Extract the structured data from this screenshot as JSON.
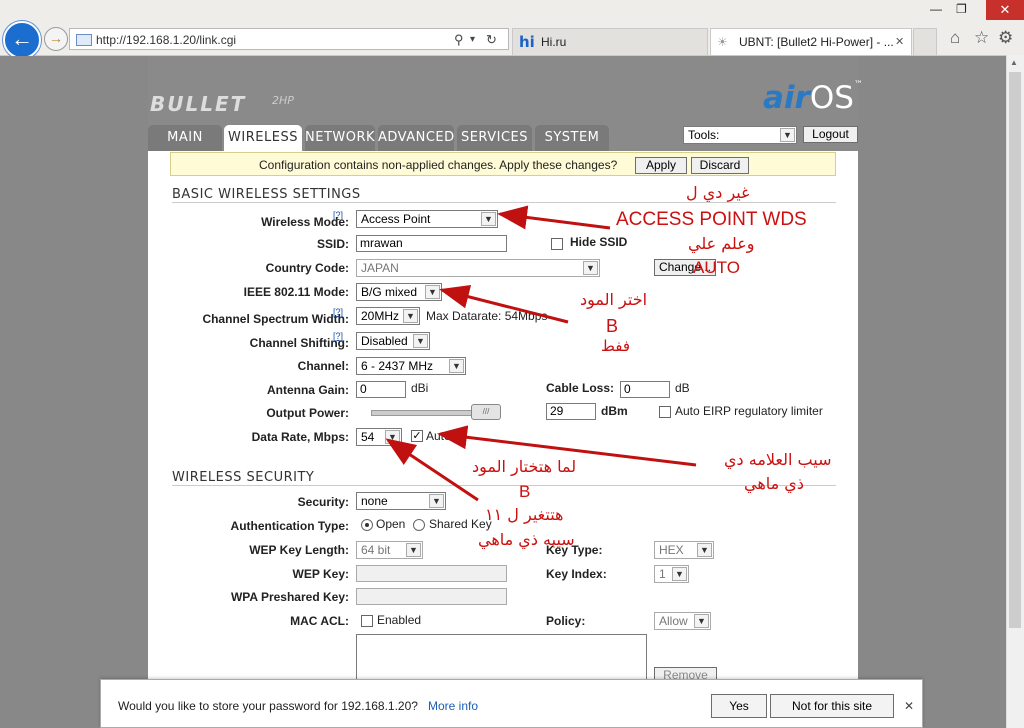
{
  "browser": {
    "address": "http://192.168.1.20/link.cgi",
    "tabs": [
      {
        "label": "Hi.ru",
        "icon": "hi"
      },
      {
        "label": "UBNT: [Bullet2 Hi-Power] - ...",
        "icon": "ubnt"
      }
    ],
    "window_controls": {
      "minimize": "—",
      "restore": "❐",
      "close": "✕"
    },
    "tab_close": "✕"
  },
  "device": {
    "logo_left": "BULLET",
    "logo_left_sub": "2HP",
    "logo_right_a": "air",
    "logo_right_b": "OS",
    "logo_right_tm": "™"
  },
  "nav": {
    "tabs": [
      "MAIN",
      "WIRELESS",
      "NETWORK",
      "ADVANCED",
      "SERVICES",
      "SYSTEM"
    ],
    "active": "WIRELESS",
    "tools_label": "Tools:",
    "logout_label": "Logout"
  },
  "notice": {
    "text": "Configuration contains non-applied changes. Apply these changes?",
    "apply": "Apply",
    "discard": "Discard"
  },
  "basic": {
    "title": "BASIC WIRELESS SETTINGS",
    "help": "[?]",
    "wireless_mode_label": "Wireless Mode:",
    "wireless_mode": "Access Point",
    "ssid_label": "SSID:",
    "ssid": "mrawan",
    "hide_ssid_label": "Hide SSID",
    "country_label": "Country Code:",
    "country": "JAPAN",
    "change_label": "Change...",
    "ieee_label": "IEEE 802.11 Mode:",
    "ieee": "B/G mixed",
    "spectrum_label": "Channel Spectrum Width:",
    "spectrum": "20MHz",
    "max_datarate": "Max Datarate: 54Mbps",
    "shifting_label": "Channel Shifting:",
    "shifting": "Disabled",
    "channel_label": "Channel:",
    "channel": "6 - 2437 MHz",
    "antenna_label": "Antenna Gain:",
    "antenna": "0",
    "antenna_unit": "dBi",
    "cable_label": "Cable Loss:",
    "cable": "0",
    "cable_unit": "dB",
    "power_label": "Output Power:",
    "power": "29",
    "power_unit": "dBm",
    "eirp_label": "Auto EIRP regulatory limiter",
    "datarate_label": "Data Rate, Mbps:",
    "datarate": "54",
    "auto_label": "Auto"
  },
  "security": {
    "title": "WIRELESS SECURITY",
    "security_label": "Security:",
    "security": "none",
    "auth_label": "Authentication Type:",
    "auth_open": "Open",
    "auth_shared": "Shared Key",
    "wep_len_label": "WEP Key Length:",
    "wep_len": "64 bit",
    "key_type_label": "Key Type:",
    "key_type": "HEX",
    "wep_key_label": "WEP Key:",
    "key_index_label": "Key Index:",
    "key_index": "1",
    "wpa_label": "WPA Preshared Key:",
    "mac_label": "MAC ACL:",
    "mac_enabled": "Enabled",
    "policy_label": "Policy:",
    "policy": "Allow",
    "remove_label": "Remove"
  },
  "annotations": {
    "a1_line1": "غير دي ل",
    "a1_line2": "ACCESS POINT WDS",
    "a1_line3": "وعلم علي",
    "a1_line4": "AUTO",
    "a2_line1": "اختر المود",
    "a2_line2": "B",
    "a2_line3": "ففط",
    "a3_line1": "سيب العلامه دي",
    "a3_line2": "ذي ماهي",
    "a4_line1": "لما هتختار المود",
    "a4_line2": "B",
    "a4_line3": "هتتغير ل ١١",
    "a4_line4": "سيبه ذي ماهي"
  },
  "password_bar": {
    "prompt": "Would you like to store your password for 192.168.1.20?",
    "more_info": "More info",
    "yes": "Yes",
    "not_for_site": "Not for this site",
    "close": "✕"
  }
}
